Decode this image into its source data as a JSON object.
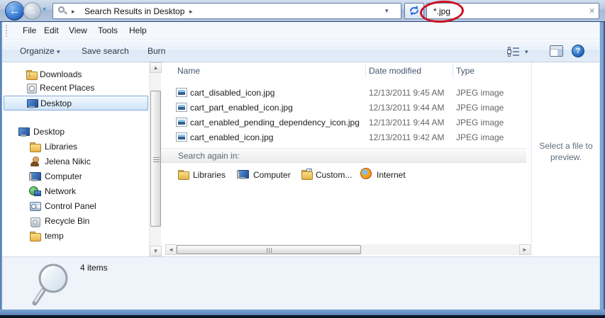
{
  "topbar": {
    "breadcrumb": "Search Results in Desktop",
    "search_value": "*.jpg"
  },
  "icons": {
    "back": "←",
    "forward": "→",
    "dropdown": "▾",
    "crumb_arrow": "▸",
    "clear": "✕",
    "help": "?",
    "up": "▲",
    "down": "▼",
    "left": "◄",
    "right": "►",
    "download_arrow": "↓",
    "check": "✓"
  },
  "menubar": {
    "items": [
      "File",
      "Edit",
      "View",
      "Tools",
      "Help"
    ]
  },
  "toolbar": {
    "organize": "Organize",
    "save_search": "Save search",
    "burn": "Burn"
  },
  "sidebar": {
    "favorites": [
      {
        "label": "Downloads",
        "icon": "downloads-folder-icon"
      },
      {
        "label": "Recent Places",
        "icon": "recent-places-icon"
      },
      {
        "label": "Desktop",
        "icon": "desktop-icon",
        "selected": true
      }
    ],
    "tree": [
      {
        "label": "Desktop",
        "icon": "desktop-icon"
      },
      {
        "label": "Libraries",
        "icon": "libraries-folder-icon"
      },
      {
        "label": "Jelena Nikic",
        "icon": "user-icon"
      },
      {
        "label": "Computer",
        "icon": "computer-icon"
      },
      {
        "label": "Network",
        "icon": "network-icon"
      },
      {
        "label": "Control Panel",
        "icon": "control-panel-icon"
      },
      {
        "label": "Recycle Bin",
        "icon": "recycle-bin-icon"
      },
      {
        "label": "temp",
        "icon": "folder-icon"
      }
    ]
  },
  "files": {
    "columns": [
      "Name",
      "Date modified",
      "Type"
    ],
    "rows": [
      {
        "name": "cart_disabled_icon.jpg",
        "date": "12/13/2011 9:45 AM",
        "type": "JPEG image"
      },
      {
        "name": "cart_part_enabled_icon.jpg",
        "date": "12/13/2011 9:44 AM",
        "type": "JPEG image"
      },
      {
        "name": "cart_enabled_pending_dependency_icon.jpg",
        "date": "12/13/2011 9:44 AM",
        "type": "JPEG image"
      },
      {
        "name": "cart_enabled_icon.jpg",
        "date": "12/13/2011 9:42 AM",
        "type": "JPEG image"
      }
    ]
  },
  "search_again": {
    "heading": "Search again in:",
    "options": [
      "Libraries",
      "Computer",
      "Custom...",
      "Internet"
    ]
  },
  "preview": {
    "message": "Select a file to preview."
  },
  "statusbar": {
    "count": "4 items"
  },
  "colors": {
    "annotation_red": "#cc1122",
    "selection_blue": "#cfe4f7",
    "topbar_blue": "#b9c9e1"
  }
}
